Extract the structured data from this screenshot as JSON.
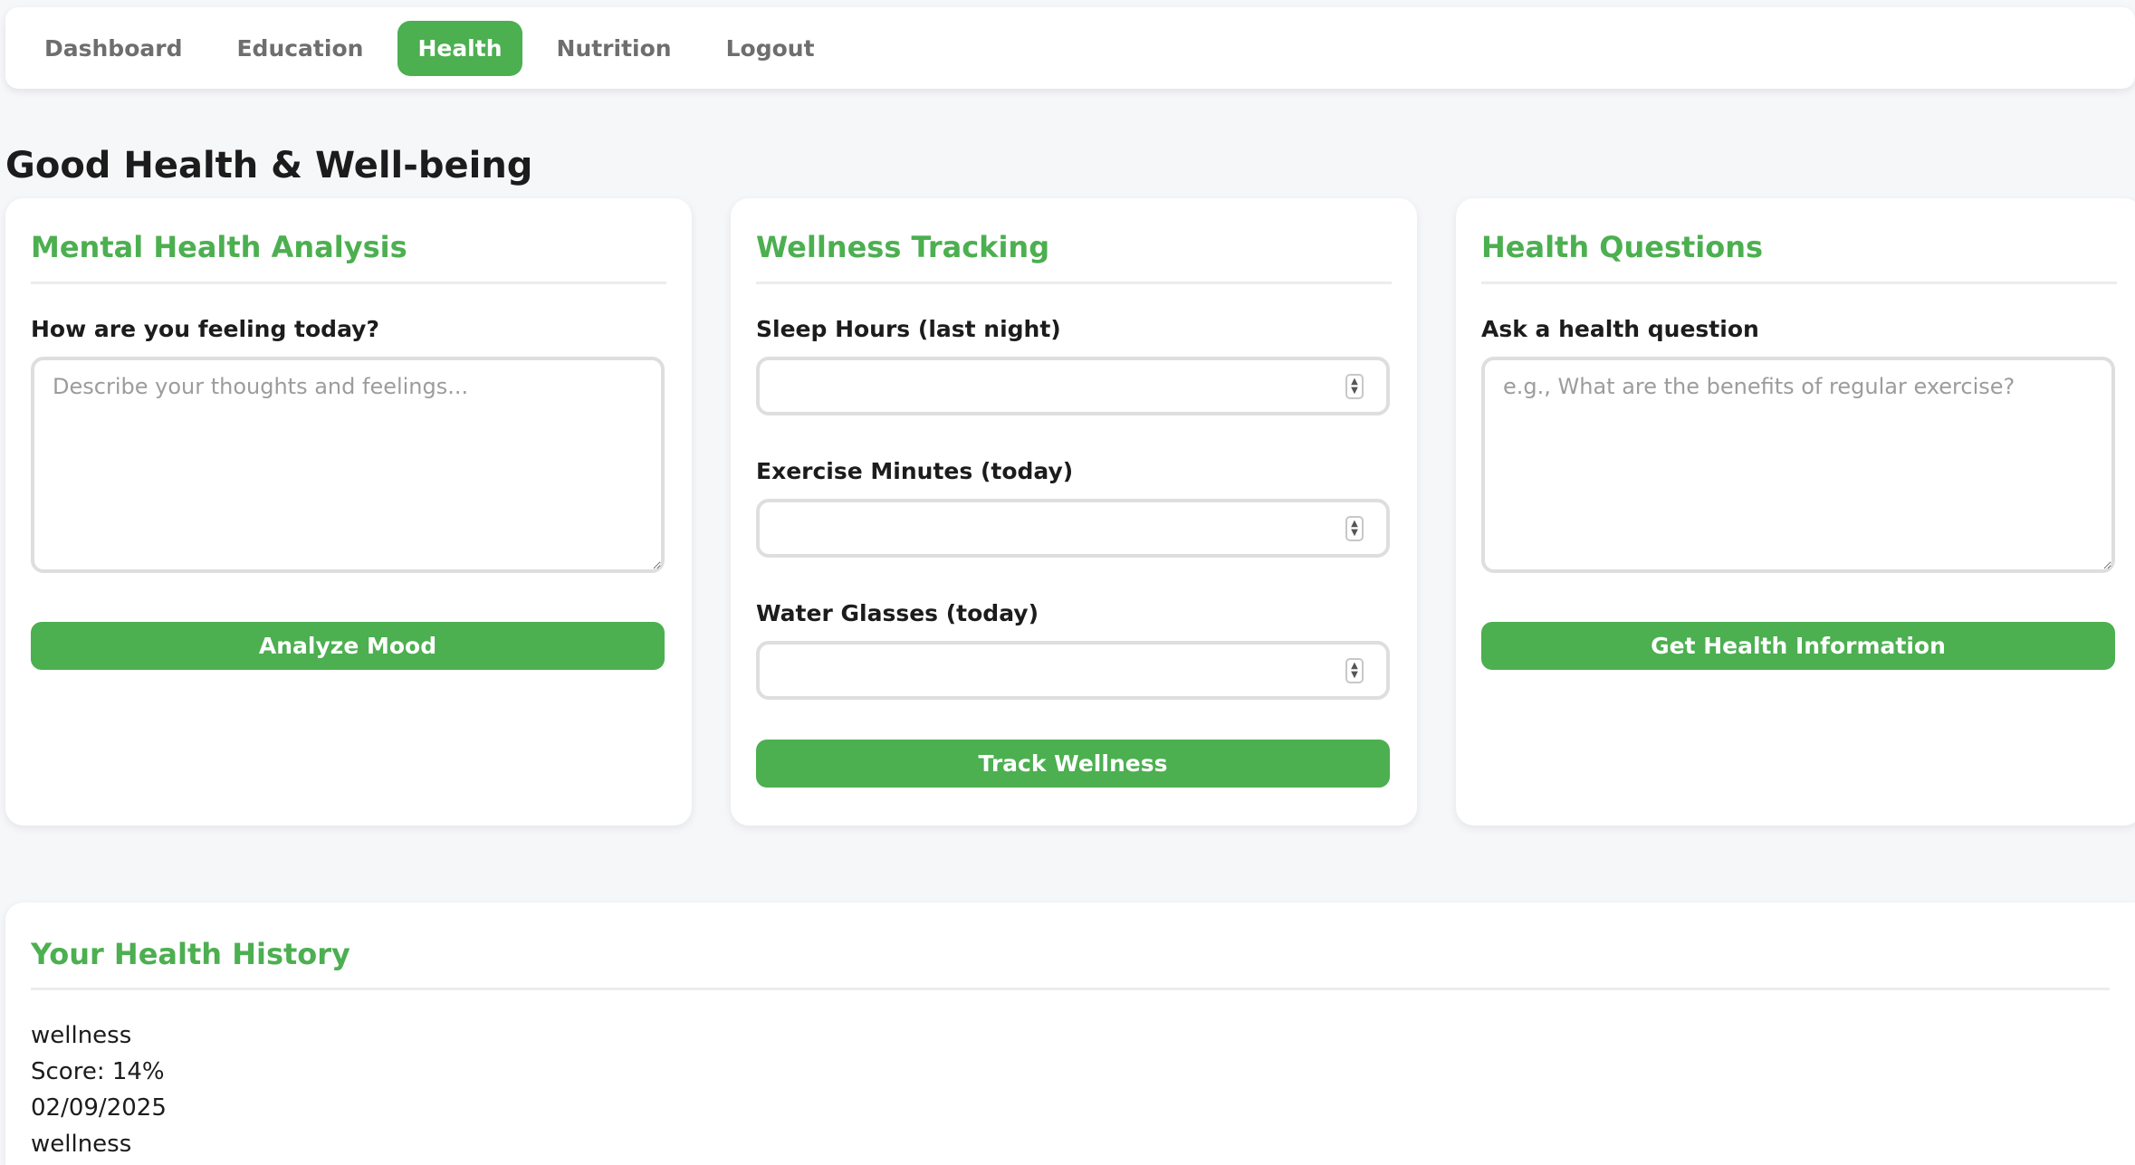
{
  "nav": {
    "items": [
      {
        "label": "Dashboard"
      },
      {
        "label": "Education"
      },
      {
        "label": "Health"
      },
      {
        "label": "Nutrition"
      },
      {
        "label": "Logout"
      }
    ],
    "active": "Health"
  },
  "page": {
    "title": "Good Health & Well-being"
  },
  "mental": {
    "title": "Mental Health Analysis",
    "label": "How are you feeling today?",
    "placeholder": "Describe your thoughts and feelings...",
    "value": "",
    "button": "Analyze Mood"
  },
  "wellness": {
    "title": "Wellness Tracking",
    "fields": [
      {
        "label": "Sleep Hours (last night)",
        "value": ""
      },
      {
        "label": "Exercise Minutes (today)",
        "value": ""
      },
      {
        "label": "Water Glasses (today)",
        "value": ""
      }
    ],
    "button": "Track Wellness"
  },
  "questions": {
    "title": "Health Questions",
    "label": "Ask a health question",
    "placeholder": "e.g., What are the benefits of regular exercise?",
    "value": "",
    "button": "Get Health Information"
  },
  "history": {
    "title": "Your Health History",
    "entries": [
      {
        "type": "wellness",
        "score": "Score: 14%",
        "date": "02/09/2025"
      },
      {
        "type": "wellness"
      }
    ]
  },
  "colors": {
    "accent": "#4caf50",
    "background": "#f6f7f9",
    "card": "#ffffff",
    "nav_text": "#6e6e6e",
    "border": "#dedede"
  }
}
